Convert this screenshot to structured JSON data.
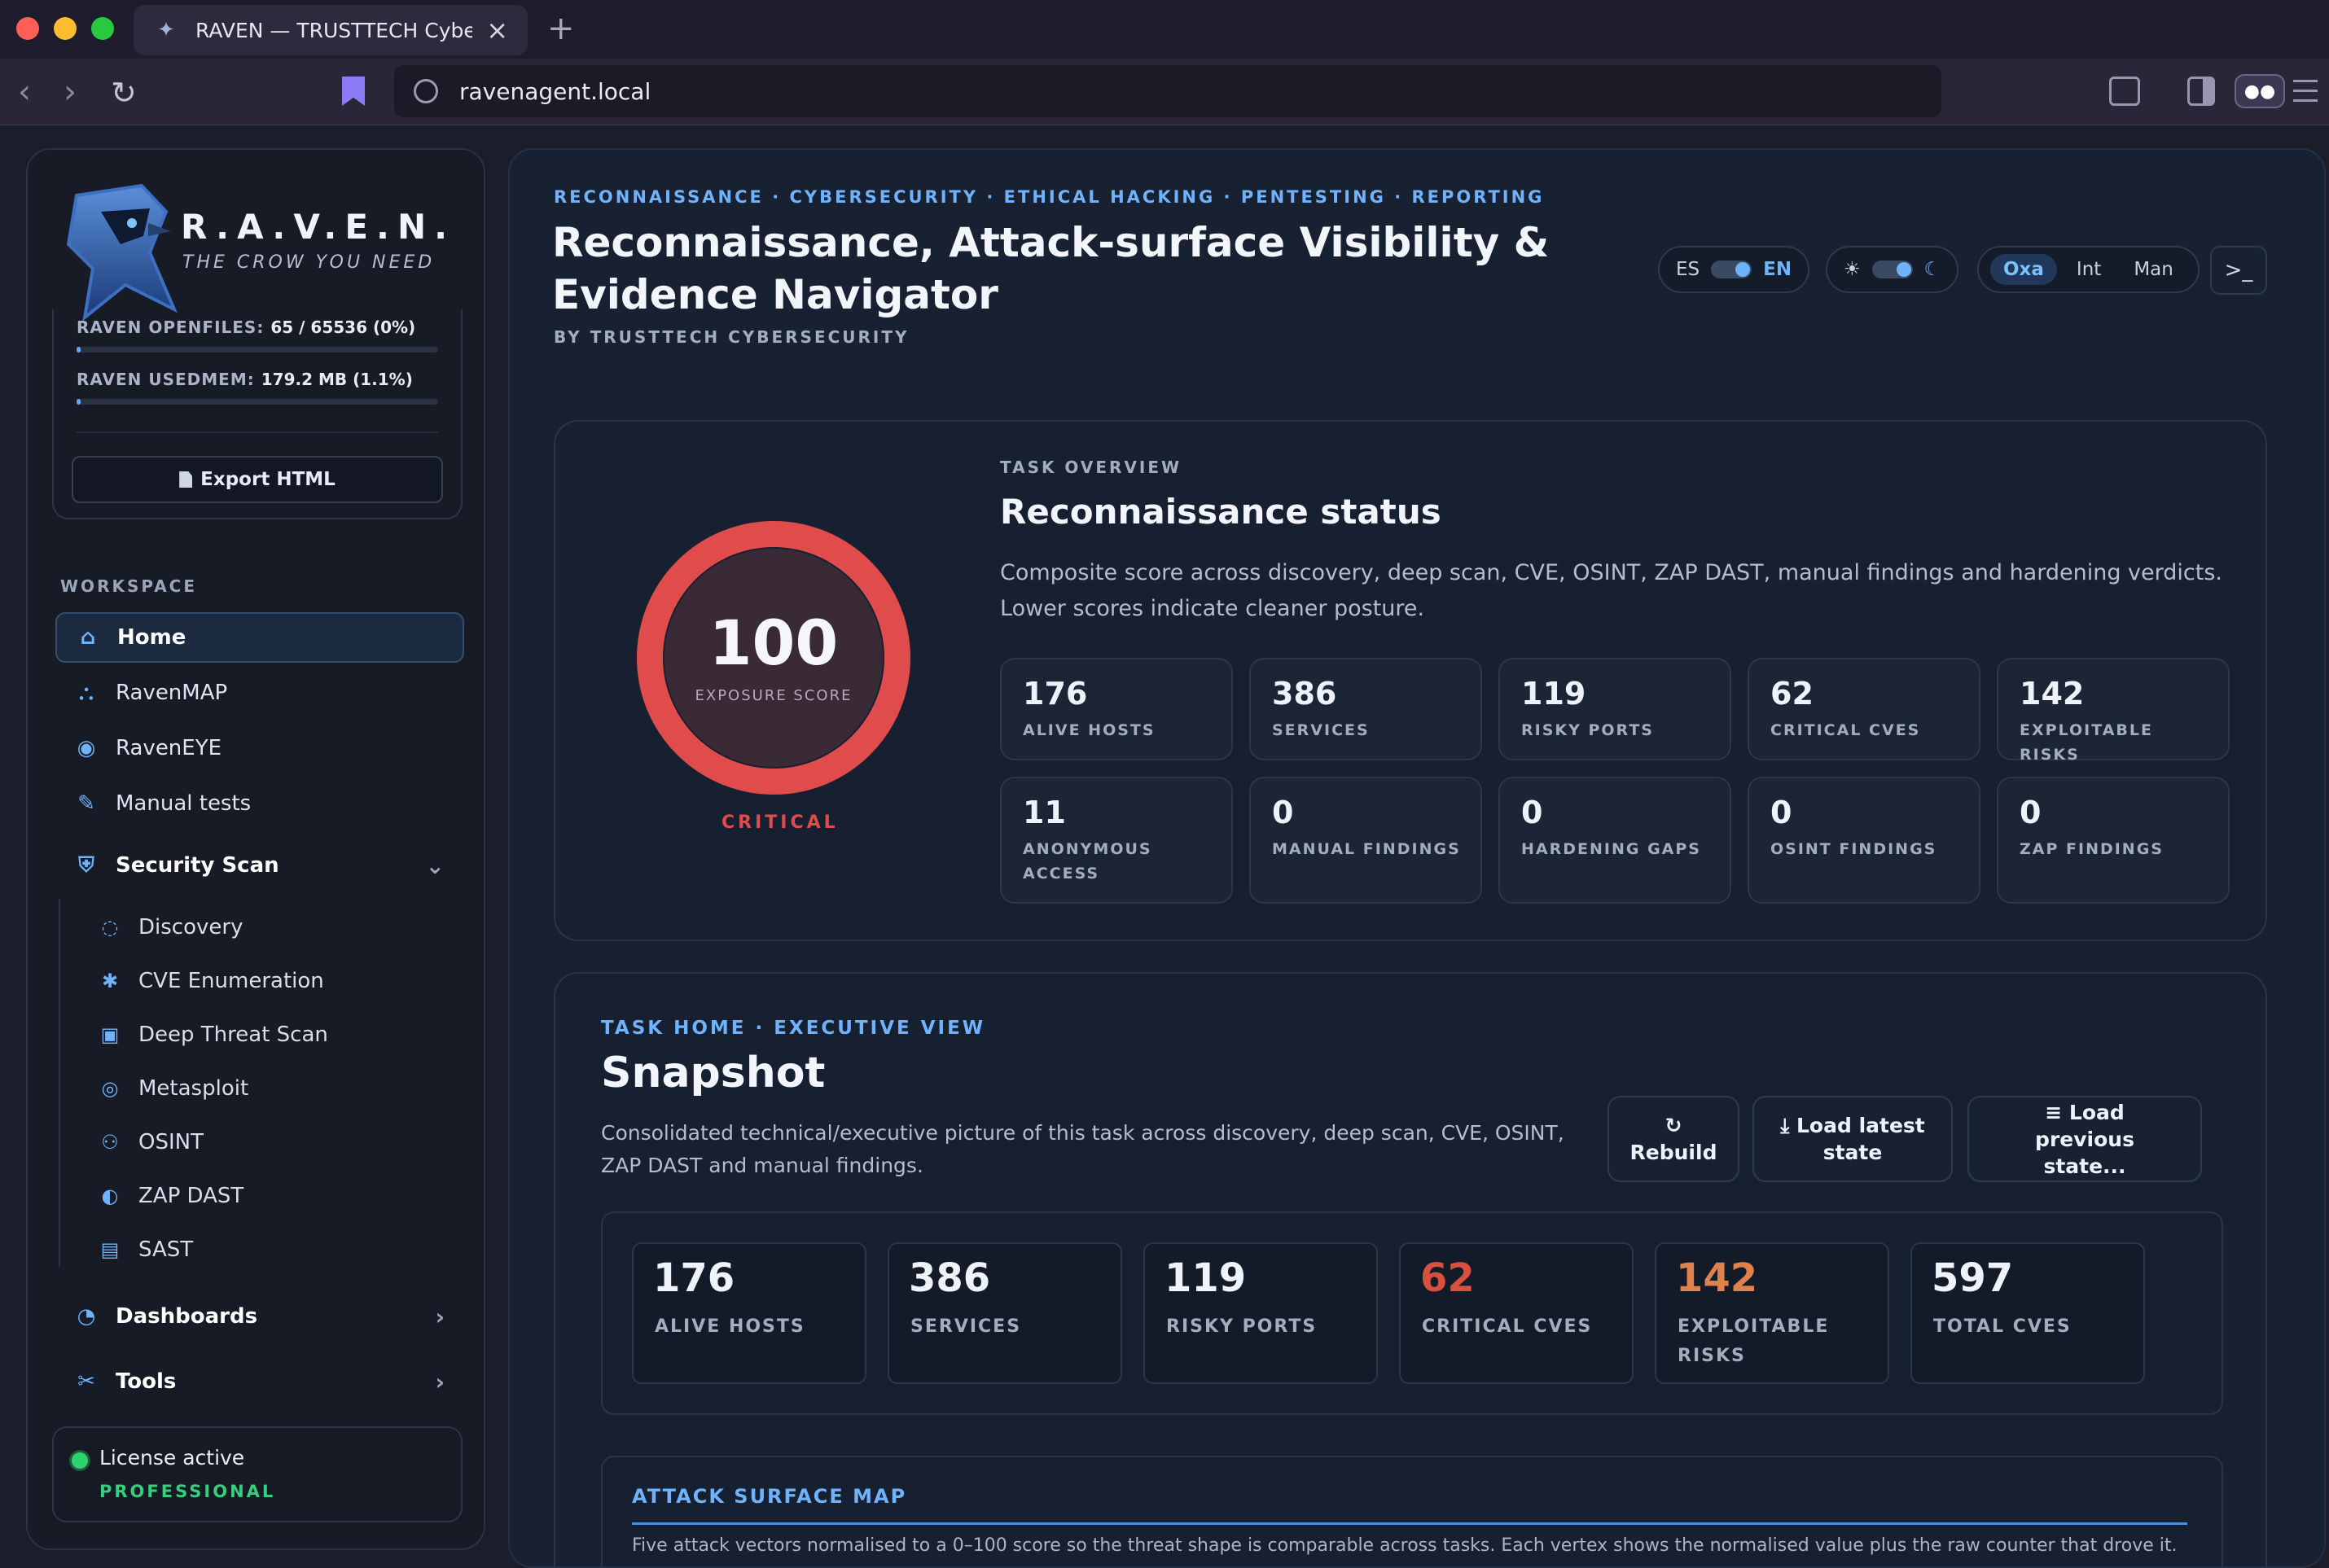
{
  "browser": {
    "tab_title": "RAVEN — TRUSTTECH Cybers",
    "url": "ravenagent.local"
  },
  "sidebar": {
    "brand_name": "R.A.V.E.N.",
    "brand_tagline": "THE CROW YOU NEED",
    "resources": [
      {
        "key": "RAVEN OPENFILES:",
        "value": "65 / 65536 (0%)",
        "fraction": 0.0
      },
      {
        "key": "RAVEN USEDMEM:",
        "value": "179.2 MB (1.1%)",
        "fraction": 0.011
      }
    ],
    "export_label": "Export HTML",
    "section_label": "WORKSPACE",
    "nav": [
      {
        "label": "Home",
        "icon": "home-icon"
      },
      {
        "label": "RavenMAP",
        "icon": "sitemap-icon"
      },
      {
        "label": "RavenEYE",
        "icon": "eye-icon"
      },
      {
        "label": "Manual tests",
        "icon": "edit-icon"
      },
      {
        "label": "Security Scan",
        "icon": "shield-icon"
      }
    ],
    "sub_nav": [
      {
        "label": "Discovery",
        "icon": "fingerprint-icon"
      },
      {
        "label": "CVE Enumeration",
        "icon": "bug-icon"
      },
      {
        "label": "Deep Threat Scan",
        "icon": "chip-icon"
      },
      {
        "label": "Metasploit",
        "icon": "target-icon"
      },
      {
        "label": "OSINT",
        "icon": "binoculars-icon"
      },
      {
        "label": "ZAP DAST",
        "icon": "shield-half-icon"
      },
      {
        "label": "SAST",
        "icon": "code-file-icon"
      }
    ],
    "dashboards_label": "Dashboards",
    "tools_label": "Tools",
    "license_text": "License active",
    "license_tier": "PROFESSIONAL"
  },
  "header": {
    "tagline": "RECONNAISSANCE · CYBERSECURITY · ETHICAL HACKING · PENTESTING · REPORTING",
    "title": "Reconnaissance, Attack-surface Visibility & Evidence Navigator",
    "byline": "BY TRUSTTECH CYBERSECURITY",
    "lang_es": "ES",
    "lang_en": "EN",
    "mode_options": [
      "Oxa",
      "Int",
      "Man"
    ],
    "mode_selected": "Oxa",
    "sun_glyph": "☀",
    "moon_glyph": "☾",
    "terminal_glyph": ">_"
  },
  "overview": {
    "score": "100",
    "score_fraction": 1.0,
    "score_label": "EXPOSURE SCORE",
    "severity": "CRITICAL",
    "kicker": "TASK OVERVIEW",
    "title": "Reconnaissance status",
    "description": "Composite score across discovery, deep scan, CVE, OSINT, ZAP DAST, manual findings and hardening verdicts. Lower scores indicate cleaner posture.",
    "stats": [
      {
        "value": "176",
        "label": "ALIVE HOSTS"
      },
      {
        "value": "386",
        "label": "SERVICES"
      },
      {
        "value": "119",
        "label": "RISKY PORTS"
      },
      {
        "value": "62",
        "label": "CRITICAL CVES"
      },
      {
        "value": "142",
        "label": "EXPLOITABLE RISKS"
      },
      {
        "value": "11",
        "label": "ANONYMOUS ACCESS"
      },
      {
        "value": "0",
        "label": "MANUAL FINDINGS"
      },
      {
        "value": "0",
        "label": "HARDENING GAPS"
      },
      {
        "value": "0",
        "label": "OSINT FINDINGS"
      },
      {
        "value": "0",
        "label": "ZAP FINDINGS"
      }
    ]
  },
  "snapshot": {
    "kicker": "TASK HOME · EXECUTIVE VIEW",
    "title": "Snapshot",
    "description": "Consolidated technical/executive picture of this task across discovery, deep scan, CVE, OSINT, ZAP DAST and manual findings.",
    "buttons": [
      {
        "glyph": "↻",
        "label": "Rebuild"
      },
      {
        "glyph": "⤓",
        "label": "Load latest state"
      },
      {
        "glyph": "≡",
        "label": "Load previous state..."
      }
    ],
    "kpis": [
      {
        "value": "176",
        "label": "ALIVE HOSTS"
      },
      {
        "value": "386",
        "label": "SERVICES"
      },
      {
        "value": "119",
        "label": "RISKY PORTS"
      },
      {
        "value": "62",
        "label": "CRITICAL CVES"
      },
      {
        "value": "142",
        "label": "EXPLOITABLE RISKS"
      },
      {
        "value": "597",
        "label": "TOTAL CVES"
      }
    ],
    "attack_title": "ATTACK SURFACE MAP",
    "attack_desc": "Five attack vectors normalised to a 0–100 score so the threat shape is comparable across tasks. Each vertex shows the normalised value plus the raw counter that drove it."
  },
  "colors": {
    "accent": "#6fb3ff",
    "critical": "#e04b4b",
    "license_ok": "#34d07c"
  }
}
